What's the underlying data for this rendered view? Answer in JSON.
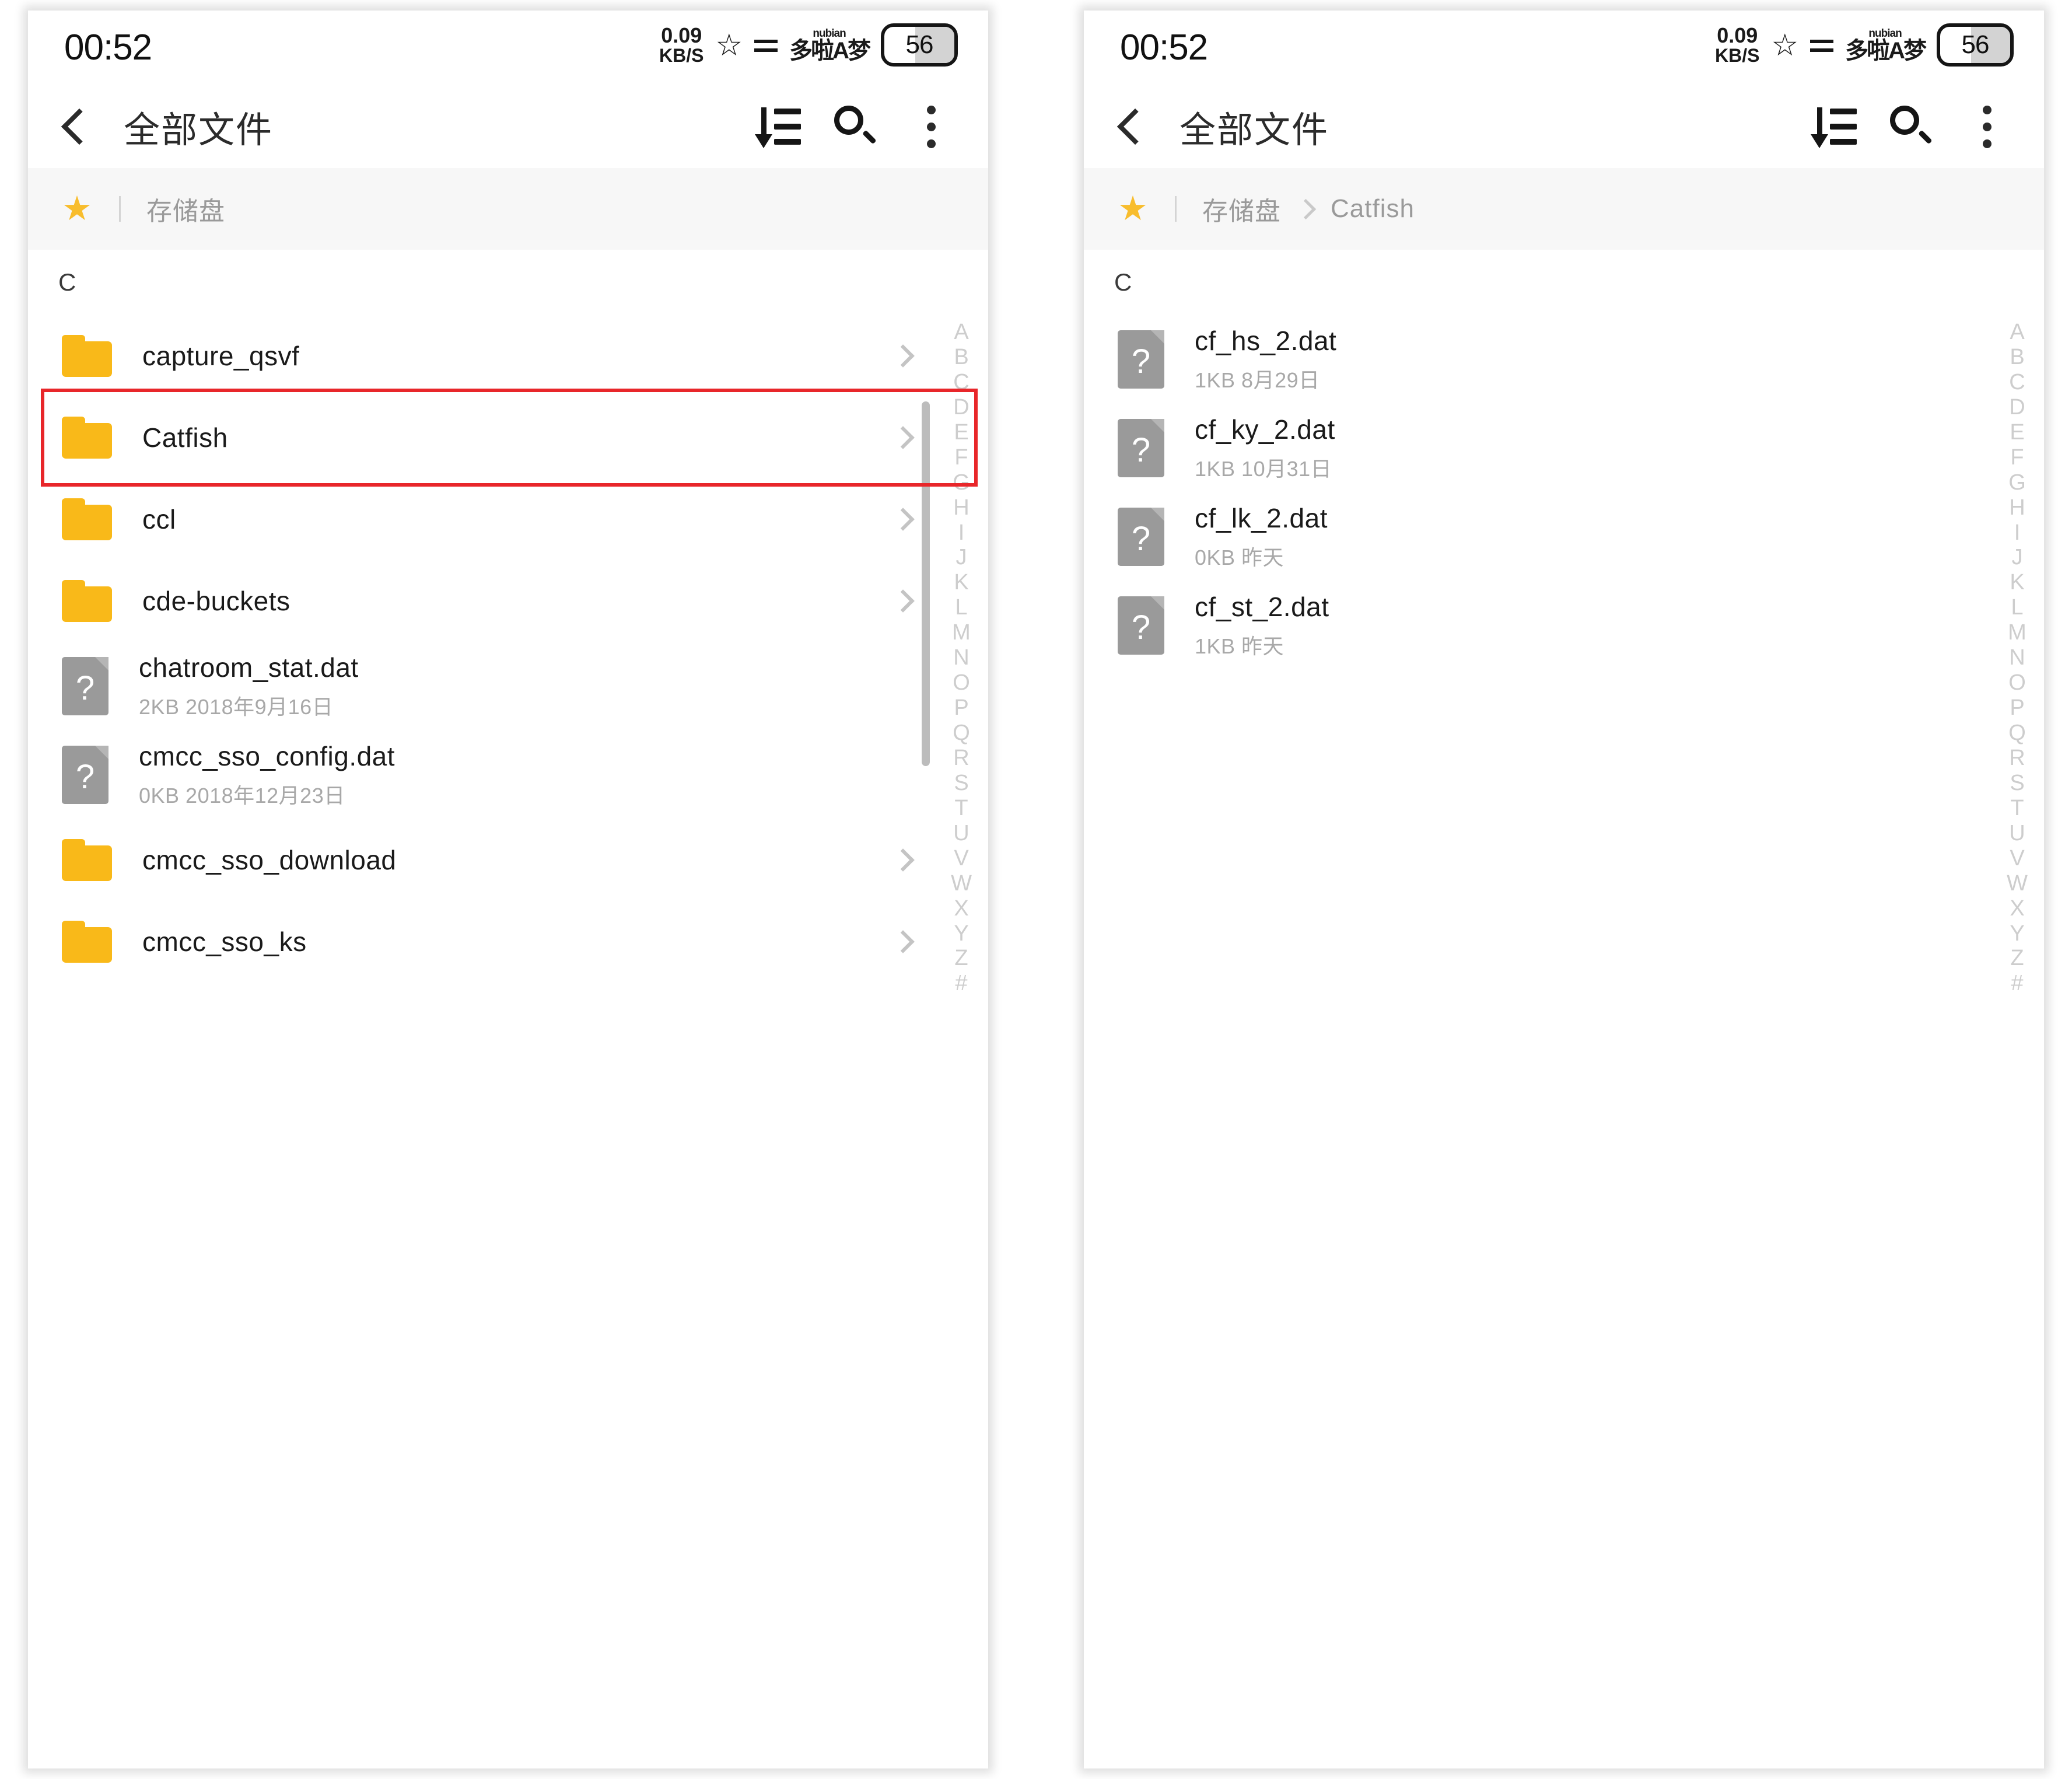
{
  "status": {
    "clock": "00:52",
    "net_speed_value": "0.09",
    "net_speed_unit": "KB/S",
    "star_icon": "star-outline-icon",
    "signal_icon": "two-bars-icon",
    "carrier_sub": "nubian",
    "carrier_main": "多啦A梦",
    "battery_level": "56"
  },
  "appbar": {
    "back_icon": "chevron-left-icon",
    "title": "全部文件",
    "sort_icon": "sort-descending-icon",
    "search_icon": "search-icon",
    "menu_icon": "kebab-menu-icon"
  },
  "colors": {
    "folder_yellow": "#f9b919",
    "star_yellow": "#f8bd2d",
    "highlight_red": "#e8262a",
    "doc_gray": "#9a9a9a",
    "crumb_bg": "#f7f7f7"
  },
  "az_index": [
    "A",
    "B",
    "C",
    "D",
    "E",
    "F",
    "G",
    "H",
    "I",
    "J",
    "K",
    "L",
    "M",
    "N",
    "O",
    "P",
    "Q",
    "R",
    "S",
    "T",
    "U",
    "V",
    "W",
    "X",
    "Y",
    "Z",
    "#"
  ],
  "panels": [
    {
      "id": "left",
      "breadcrumb": {
        "star_icon": "star-filled-icon",
        "items": [
          "存储盘"
        ]
      },
      "section_header": "C",
      "highlighted_row_index": 1,
      "rows": [
        {
          "type": "folder",
          "name": "capture_qsvf",
          "meta": ""
        },
        {
          "type": "folder",
          "name": "Catfish",
          "meta": ""
        },
        {
          "type": "folder",
          "name": "ccl",
          "meta": ""
        },
        {
          "type": "folder",
          "name": "cde-buckets",
          "meta": ""
        },
        {
          "type": "file",
          "name": "chatroom_stat.dat",
          "meta": "2KB  2018年9月16日"
        },
        {
          "type": "file",
          "name": "cmcc_sso_config.dat",
          "meta": "0KB  2018年12月23日"
        },
        {
          "type": "folder",
          "name": "cmcc_sso_download",
          "meta": ""
        },
        {
          "type": "folder",
          "name": "cmcc_sso_ks",
          "meta": ""
        }
      ],
      "scrollbar": {
        "visible": true,
        "top_pct": 10,
        "height_pct": 24
      }
    },
    {
      "id": "right",
      "breadcrumb": {
        "star_icon": "star-filled-icon",
        "items": [
          "存储盘",
          "Catfish"
        ]
      },
      "section_header": "C",
      "highlighted_row_index": -1,
      "rows": [
        {
          "type": "file",
          "name": "cf_hs_2.dat",
          "meta": "1KB  8月29日"
        },
        {
          "type": "file",
          "name": "cf_ky_2.dat",
          "meta": "1KB  10月31日"
        },
        {
          "type": "file",
          "name": "cf_lk_2.dat",
          "meta": "0KB  昨天"
        },
        {
          "type": "file",
          "name": "cf_st_2.dat",
          "meta": "1KB  昨天"
        }
      ],
      "scrollbar": {
        "visible": false,
        "top_pct": 0,
        "height_pct": 0
      }
    }
  ]
}
